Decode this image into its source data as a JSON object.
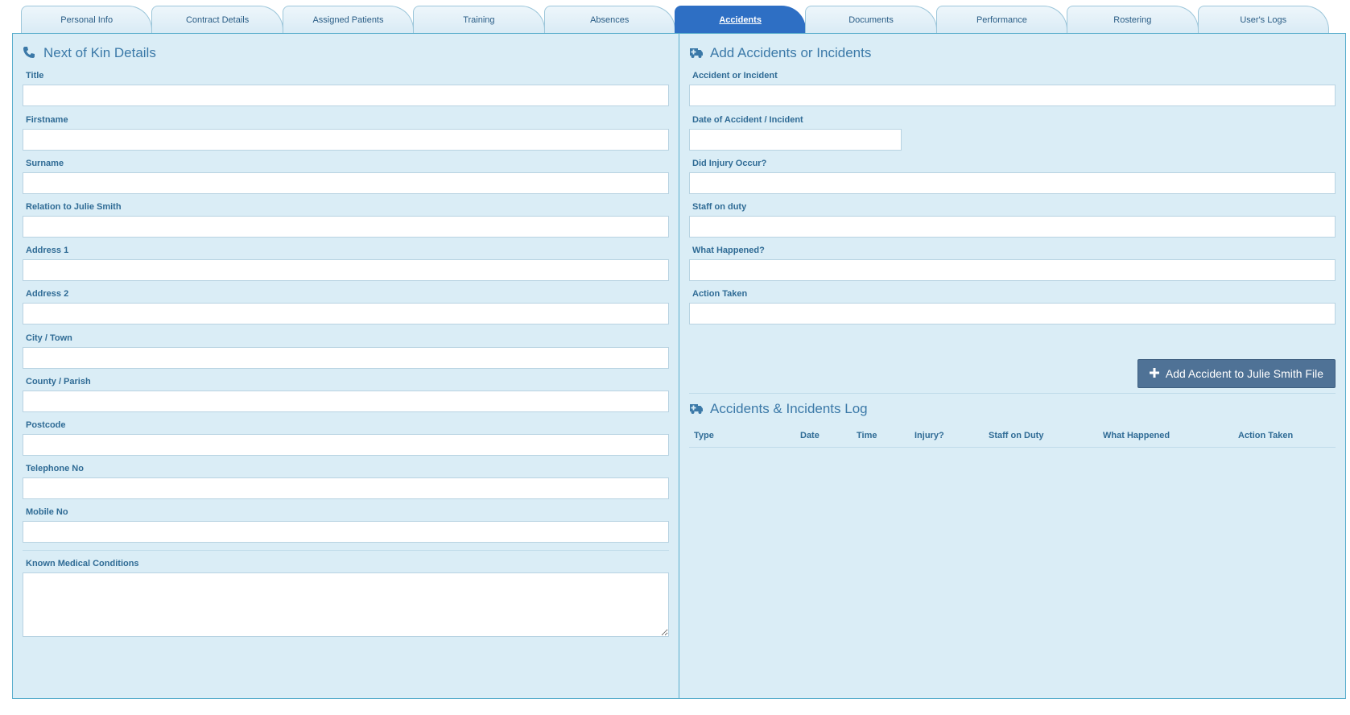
{
  "tabs": [
    {
      "label": "Personal Info"
    },
    {
      "label": "Contract Details"
    },
    {
      "label": "Assigned Patients"
    },
    {
      "label": "Training"
    },
    {
      "label": "Absences"
    },
    {
      "label": "Accidents",
      "active": true
    },
    {
      "label": "Documents"
    },
    {
      "label": "Performance"
    },
    {
      "label": "Rostering"
    },
    {
      "label": "User's Logs"
    }
  ],
  "next_of_kin": {
    "title": "Next of Kin Details",
    "icon": "phone-icon",
    "fields": {
      "title": {
        "label": "Title",
        "value": ""
      },
      "firstname": {
        "label": "Firstname",
        "value": ""
      },
      "surname": {
        "label": "Surname",
        "value": ""
      },
      "relation": {
        "label": "Relation to Julie Smith",
        "value": ""
      },
      "address1": {
        "label": "Address 1",
        "value": ""
      },
      "address2": {
        "label": "Address 2",
        "value": ""
      },
      "city": {
        "label": "City / Town",
        "value": ""
      },
      "county": {
        "label": "County / Parish",
        "value": ""
      },
      "postcode": {
        "label": "Postcode",
        "value": ""
      },
      "telephone": {
        "label": "Telephone No",
        "value": ""
      },
      "mobile": {
        "label": "Mobile No",
        "value": ""
      },
      "medical": {
        "label": "Known Medical Conditions",
        "value": ""
      }
    }
  },
  "accidents": {
    "title": "Add Accidents or Incidents",
    "icon": "ambulance-icon",
    "fields": {
      "type": {
        "label": "Accident or Incident",
        "value": ""
      },
      "date": {
        "label": "Date of Accident / Incident",
        "value": ""
      },
      "injury": {
        "label": "Did Injury Occur?",
        "value": ""
      },
      "staff": {
        "label": "Staff on duty",
        "value": ""
      },
      "what": {
        "label": "What Happened?",
        "value": ""
      },
      "action": {
        "label": "Action Taken",
        "value": ""
      }
    },
    "add_button": {
      "label": "Add Accident to Julie Smith File",
      "icon": "plus-icon"
    }
  },
  "log": {
    "title": "Accidents & Incidents Log",
    "icon": "ambulance-icon",
    "columns": [
      "Type",
      "Date",
      "Time",
      "Injury?",
      "Staff on Duty",
      "What Happened",
      "Action Taken"
    ]
  },
  "colors": {
    "panel_bg": "#daedf6",
    "panel_border": "#5aaecd",
    "active_tab": "#2e6fc4",
    "button": "#4f7296",
    "label": "#2f6b95"
  }
}
